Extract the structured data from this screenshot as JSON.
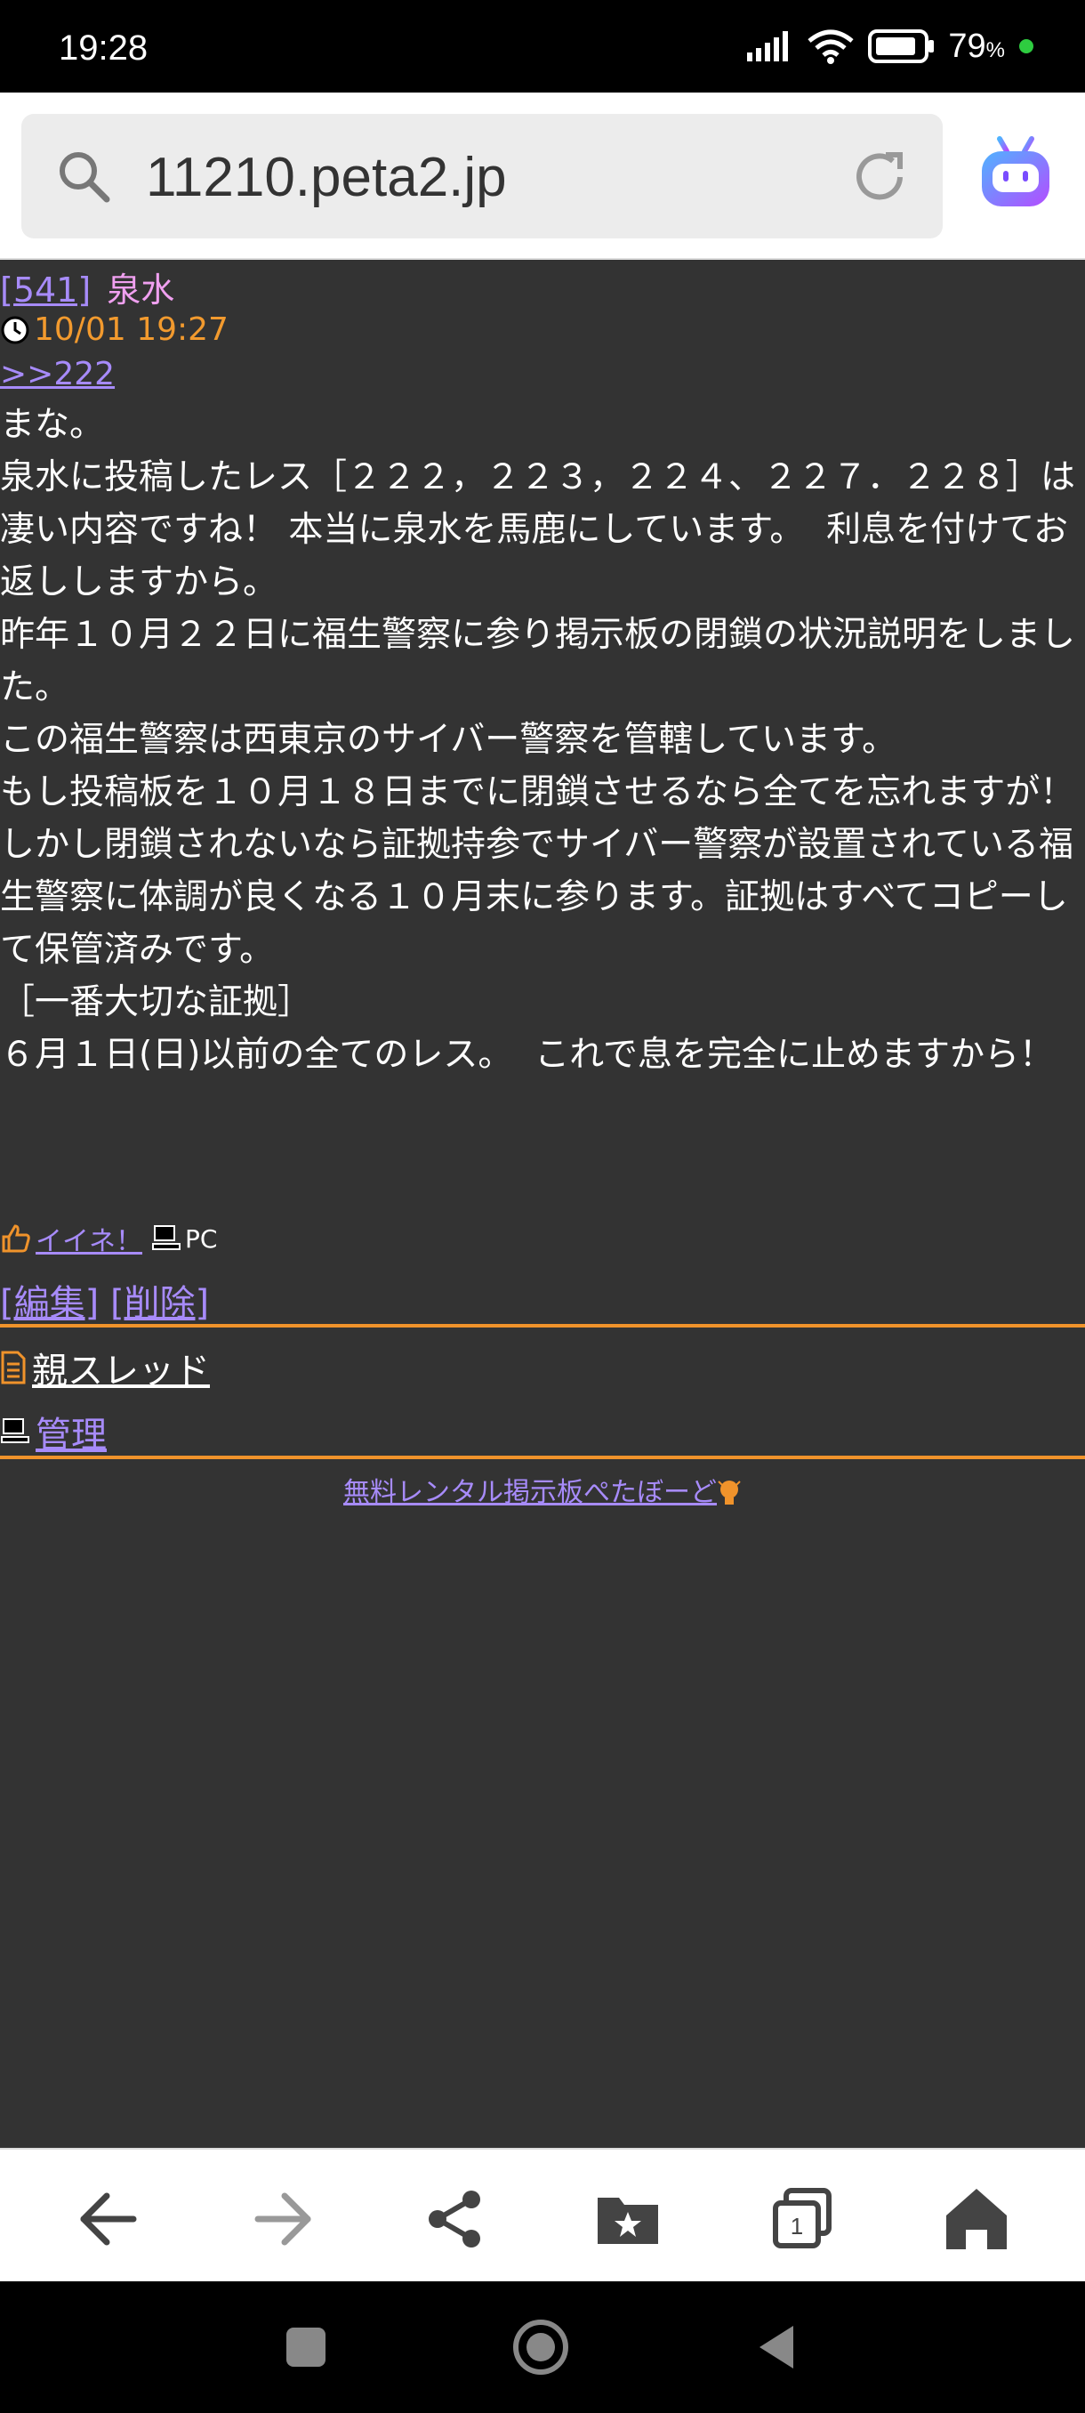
{
  "status_bar": {
    "time": "19:28",
    "battery": "79",
    "battery_unit": "%"
  },
  "browser": {
    "url": "11210.peta2.jp"
  },
  "post": {
    "number": "[541]",
    "name": "泉水",
    "date": "10/01 19:27",
    "reply_to": ">>222",
    "body": "まな。\n泉水に投稿したレス［２２２，２２３，２２４、２２７．２２８］は凄い内容ですね！ 本当に泉水を馬鹿にしています。  利息を付けてお返ししますから。\n昨年１０月２２日に福生警察に参り掲示板の閉鎖の状況説明をしました。\nこの福生警察は西東京のサイバー警察を管轄しています。\nもし投稿板を１０月１８日までに閉鎖させるなら全てを忘れますが！\nしかし閉鎖されないなら証拠持参でサイバー警察が設置されている福生警察に体調が良くなる１０月末に参ります。証拠はすべてコピーして保管済みです。\n［一番大切な証拠］\n６月１日(日)以前の全てのレス。  これで息を完全に止めますから！",
    "like_label": "イイネ！",
    "device": "PC",
    "edit_label": "[編集]",
    "delete_label": "[削除]"
  },
  "menu": {
    "parent_thread": "親スレッド",
    "admin": "管理"
  },
  "footer": {
    "link": "無料レンタル掲示板ぺたぼーど"
  },
  "colors": {
    "accent": "#f0932b",
    "link": "#a78bfa",
    "background": "#333333",
    "name": "#f0a0f0",
    "date": "#f29a2e"
  }
}
